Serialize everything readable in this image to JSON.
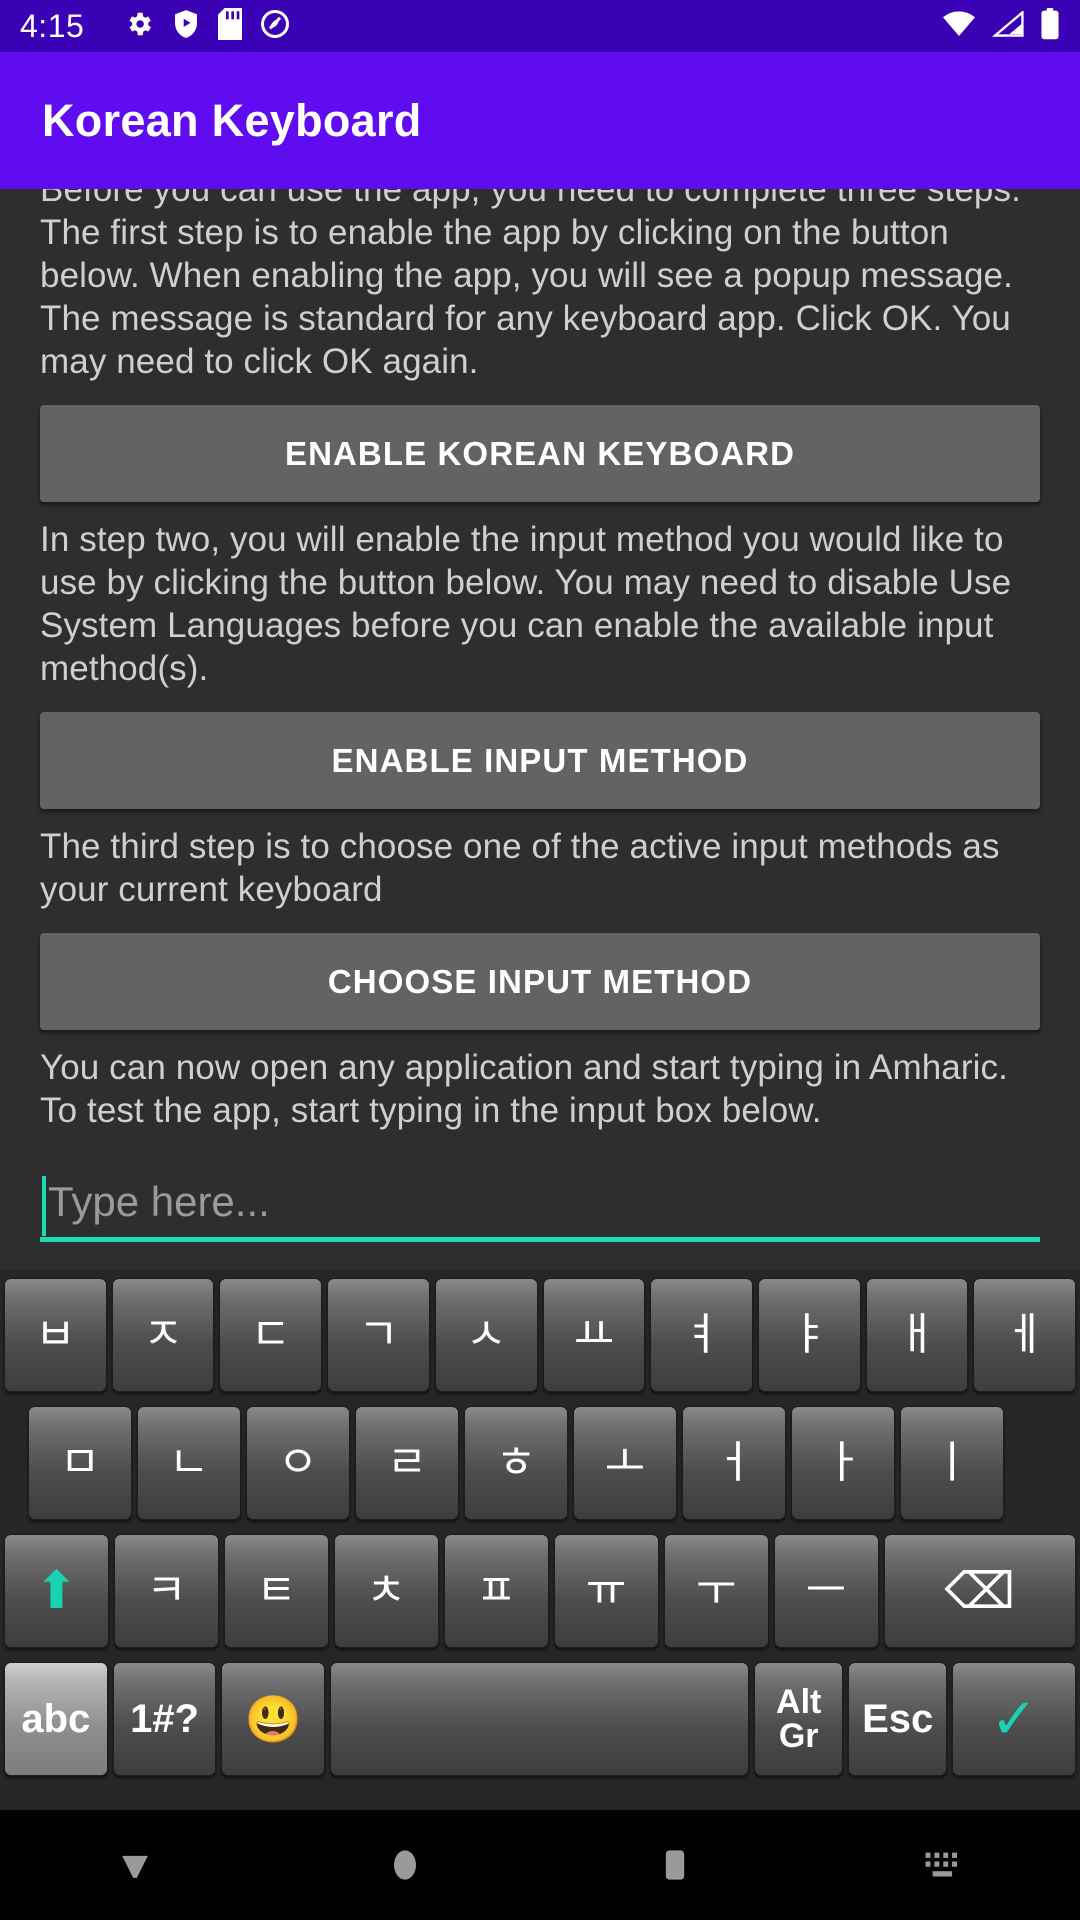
{
  "statusbar": {
    "time": "4:15",
    "left_icons": [
      "gear-icon",
      "shield-play-icon",
      "sd-card-icon",
      "no-cast-icon"
    ],
    "right_icons": [
      "wifi-icon",
      "cellular-signal-icon",
      "battery-icon"
    ],
    "background": "#3b02b5"
  },
  "appbar": {
    "title": "Korean Keyboard",
    "background": "#5f0df0"
  },
  "content": {
    "paragraph1": "Before you can use the app, you need to complete three steps. The first step is to enable the app by clicking on the button below. When enabling the app, you will see a popup message. The message is standard for any keyboard app. Click OK. You may need to click OK again.",
    "button1": "ENABLE KOREAN KEYBOARD",
    "paragraph2": "In step two, you will enable the input method you would like to use by clicking the button below. You may need to disable Use System Languages before you can enable the available input method(s).",
    "button2": "ENABLE INPUT METHOD",
    "paragraph3": "The third step is to choose one of the active input methods as your current keyboard",
    "button3": "CHOOSE INPUT METHOD",
    "paragraph4": "You can now open any application and start typing in Amharic. To test the app, start typing in the input box below.",
    "input_value": "",
    "input_placeholder": "Type here...",
    "accent_color": "#1fd8b4"
  },
  "keyboard": {
    "row1": [
      {
        "label": "ㅂ",
        "name": "key-bieup"
      },
      {
        "label": "ㅈ",
        "name": "key-jieut"
      },
      {
        "label": "ㄷ",
        "name": "key-digeut"
      },
      {
        "label": "ㄱ",
        "name": "key-giyeok"
      },
      {
        "label": "ㅅ",
        "name": "key-siot"
      },
      {
        "label": "ㅛ",
        "name": "key-yo"
      },
      {
        "label": "ㅕ",
        "name": "key-yeo"
      },
      {
        "label": "ㅑ",
        "name": "key-ya"
      },
      {
        "label": "ㅐ",
        "name": "key-ae"
      },
      {
        "label": "ㅔ",
        "name": "key-e"
      }
    ],
    "row2": [
      {
        "label": "ㅁ",
        "name": "key-mieum"
      },
      {
        "label": "ㄴ",
        "name": "key-nieun"
      },
      {
        "label": "ㅇ",
        "name": "key-ieung"
      },
      {
        "label": "ㄹ",
        "name": "key-rieul"
      },
      {
        "label": "ㅎ",
        "name": "key-hieut"
      },
      {
        "label": "ㅗ",
        "name": "key-o"
      },
      {
        "label": "ㅓ",
        "name": "key-eo"
      },
      {
        "label": "ㅏ",
        "name": "key-a"
      },
      {
        "label": "ㅣ",
        "name": "key-i"
      }
    ],
    "row3": [
      {
        "label": "⬆",
        "name": "shift-key",
        "type": "teal"
      },
      {
        "label": "ㅋ",
        "name": "key-kieuk"
      },
      {
        "label": "ㅌ",
        "name": "key-tieut"
      },
      {
        "label": "ㅊ",
        "name": "key-chieut"
      },
      {
        "label": "ㅍ",
        "name": "key-pieup"
      },
      {
        "label": "ㅠ",
        "name": "key-yu"
      },
      {
        "label": "ㅜ",
        "name": "key-u"
      },
      {
        "label": "ㅡ",
        "name": "key-eu"
      },
      {
        "label": "⌫",
        "name": "backspace-key",
        "type": "wide"
      }
    ],
    "row4": [
      {
        "label": "abc",
        "name": "abc-key"
      },
      {
        "label": "1#?",
        "name": "symbols-key"
      },
      {
        "label": "😃",
        "name": "emoji-key"
      },
      {
        "label": "",
        "name": "space-key"
      },
      {
        "label": "Alt\nGr",
        "name": "altgr-key"
      },
      {
        "label": "Esc",
        "name": "esc-key"
      },
      {
        "label": "✓",
        "name": "enter-key",
        "type": "teal"
      }
    ]
  },
  "navbar": {
    "items": [
      "back-button",
      "home-button",
      "recents-button",
      "keyboard-switch-button"
    ]
  }
}
